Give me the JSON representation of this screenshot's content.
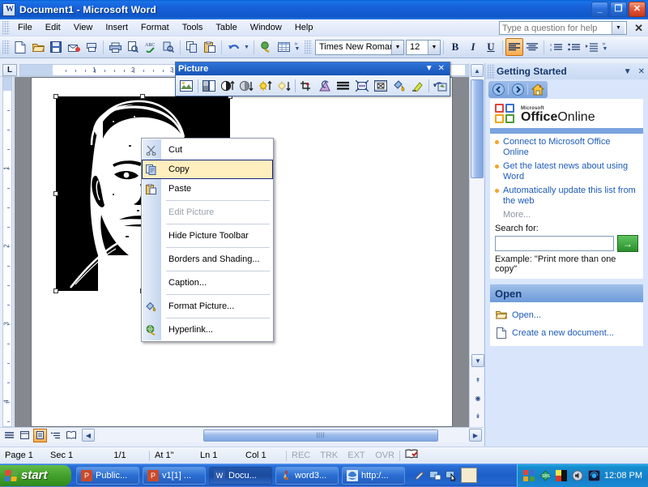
{
  "window": {
    "title": "Document1 - Microsoft Word",
    "app_icon": "word-document-icon",
    "minimize_label": "_",
    "restore_label": "❐",
    "close_label": "✕"
  },
  "menubar": {
    "items": [
      "File",
      "Edit",
      "View",
      "Insert",
      "Format",
      "Tools",
      "Table",
      "Window",
      "Help"
    ],
    "ask_a_question": {
      "placeholder": "Type a question for help",
      "value": ""
    },
    "close_label": "✕"
  },
  "toolbar": {
    "standard_icons": [
      "new-document-icon",
      "open-folder-icon",
      "save-icon",
      "email-icon",
      "print-preview-search-icon",
      "print-icon",
      "print-preview-icon",
      "spelling-grammar-icon",
      "research-icon",
      "copy-icon",
      "paste-icon",
      "undo-icon",
      "undo-dropdown-icon",
      "insert-hyperlink-icon",
      "insert-table-icon"
    ],
    "font_name": "Times New Roman",
    "font_size": "12",
    "bold_label": "B",
    "italic_label": "I",
    "underline_label": "U",
    "align_left_label": "align-left-icon",
    "align_center_label": "align-center-icon",
    "numbering_label": "numbering-icon",
    "bullets_label": "bullets-icon",
    "indent_label": "increase-indent-icon",
    "overflow_label": "»"
  },
  "ruler": {
    "tab_stop_label": "L",
    "h_numbers": [
      "1",
      "2",
      "3"
    ],
    "v_numbers": [
      "1",
      "2",
      "3",
      "4"
    ]
  },
  "picture_toolbar": {
    "title": "Picture",
    "dropdown_label": "▼",
    "close_label": "✕",
    "buttons": [
      "insert-picture-icon",
      "color-icon",
      "more-contrast-icon",
      "less-contrast-icon",
      "more-brightness-icon",
      "less-brightness-icon",
      "crop-icon",
      "rotate-left-icon",
      "line-style-icon",
      "compress-pictures-icon",
      "text-wrapping-icon",
      "format-picture-icon",
      "set-transparent-color-icon",
      "reset-picture-icon"
    ]
  },
  "context_menu": {
    "items": [
      {
        "label": "Cut",
        "icon": "scissors-icon",
        "enabled": true,
        "highlighted": false,
        "separator_after": false
      },
      {
        "label": "Copy",
        "icon": "copy-icon",
        "enabled": true,
        "highlighted": true,
        "separator_after": false
      },
      {
        "label": "Paste",
        "icon": "clipboard-icon",
        "enabled": true,
        "highlighted": false,
        "separator_after": true
      },
      {
        "label": "Edit Picture",
        "icon": "",
        "enabled": false,
        "highlighted": false,
        "separator_after": true
      },
      {
        "label": "Hide Picture Toolbar",
        "icon": "",
        "enabled": true,
        "highlighted": false,
        "separator_after": true
      },
      {
        "label": "Borders and Shading...",
        "icon": "",
        "enabled": true,
        "highlighted": false,
        "separator_after": true
      },
      {
        "label": "Caption...",
        "icon": "",
        "enabled": true,
        "highlighted": false,
        "separator_after": true
      },
      {
        "label": "Format Picture...",
        "icon": "paint-bucket-icon",
        "enabled": true,
        "highlighted": false,
        "separator_after": true
      },
      {
        "label": "Hyperlink...",
        "icon": "globe-link-icon",
        "enabled": true,
        "highlighted": false,
        "separator_after": false
      }
    ]
  },
  "task_pane": {
    "title": "Getting Started",
    "dropdown_label": "▼",
    "close_label": "✕",
    "nav": {
      "back": "back-arrow-icon",
      "forward": "forward-arrow-icon",
      "home": "home-icon"
    },
    "brand": {
      "microsoft": "Microsoft",
      "office": "Office",
      "online": "Online"
    },
    "links": [
      "Connect to Microsoft Office Online",
      "Get the latest news about using Word",
      "Automatically update this list from the web"
    ],
    "more_label": "More...",
    "search_label": "Search for:",
    "search_value": "",
    "go_label": "→",
    "example_text": "Example: \"Print more than one copy\"",
    "open_section_title": "Open",
    "open_items": [
      {
        "label": "Open...",
        "icon": "open-folder-icon"
      },
      {
        "label": "Create a new document...",
        "icon": "new-document-icon"
      }
    ]
  },
  "document": {
    "picture_alt": "high-contrast-portrait-image",
    "selected": true
  },
  "view_buttons": {
    "items": [
      "normal-view-icon",
      "web-layout-view-icon",
      "print-layout-view-icon",
      "outline-view-icon",
      "reading-layout-view-icon"
    ],
    "selected_index": 2
  },
  "status_bar": {
    "page": "Page  1",
    "section": "Sec  1",
    "page_of": "1/1",
    "at": "At  1\"",
    "line": "Ln  1",
    "column": "Col  1",
    "rec": "REC",
    "trk": "TRK",
    "ext": "EXT",
    "ovr": "OVR",
    "language_icon": "spell-check-icon"
  },
  "taskbar": {
    "start_label": "start",
    "tasks": [
      {
        "label": "Public...",
        "icon": "powerpoint-icon",
        "active": false
      },
      {
        "label": "v1[1] ...",
        "icon": "powerpoint-icon",
        "active": false
      },
      {
        "label": "Docu...",
        "icon": "word-icon",
        "active": true
      },
      {
        "label": "word3...",
        "icon": "paint-icon",
        "active": false
      },
      {
        "label": "http:/...",
        "icon": "ie-icon",
        "active": false
      }
    ],
    "quick_launch": [
      "pen-icon",
      "messenger-icon",
      "cursor-icon",
      "notepad-icon"
    ],
    "tray_icons": [
      "office-icon",
      "sbs-icon",
      "color-squares-icon",
      "volume-icon",
      "network-icon"
    ],
    "clock": "12:08 PM"
  }
}
